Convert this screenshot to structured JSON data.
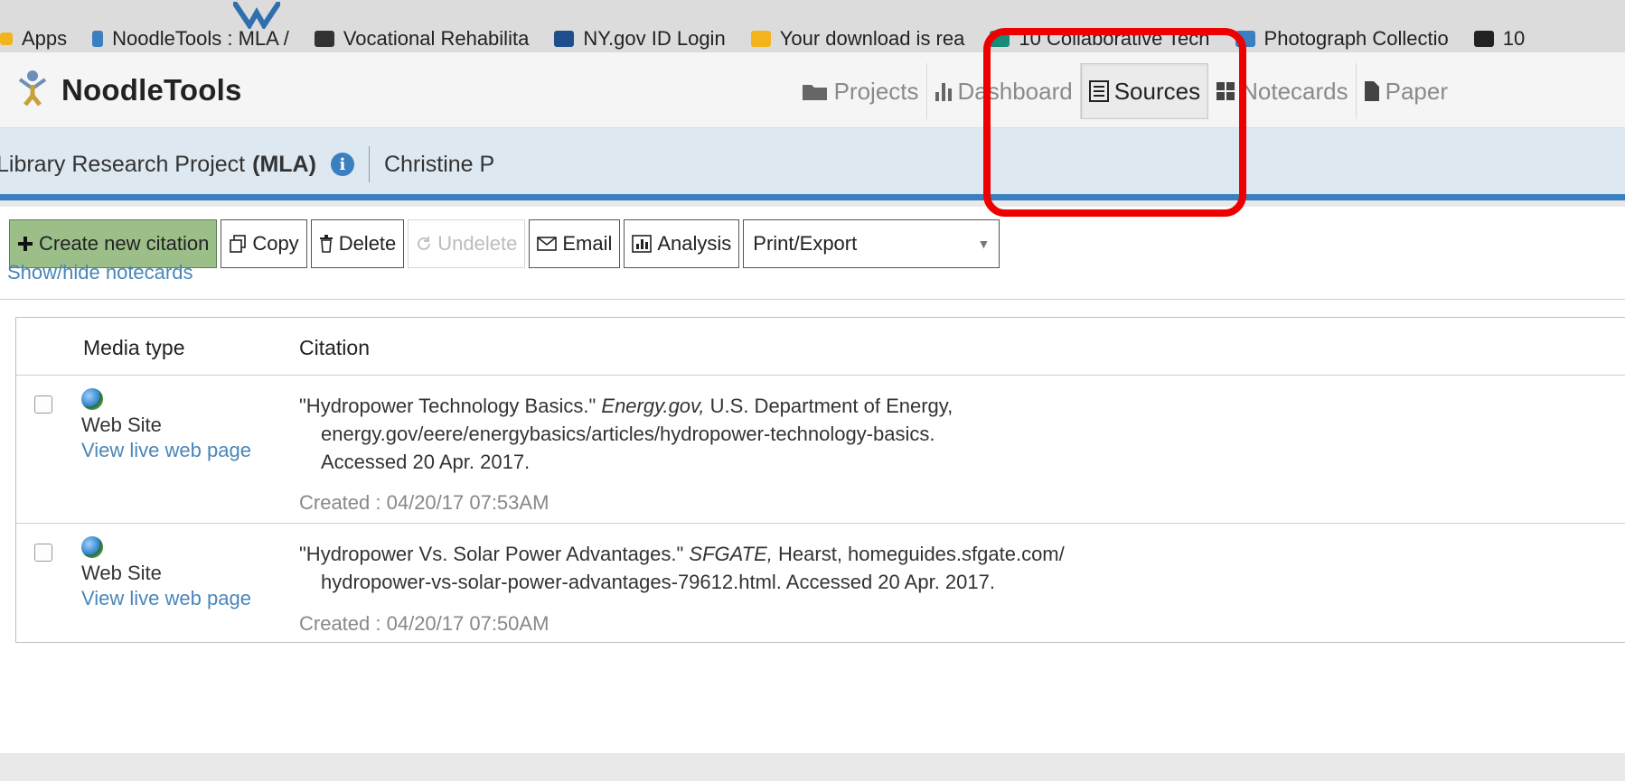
{
  "bookmarks": [
    {
      "label": "Apps",
      "color": "#f3b41b"
    },
    {
      "label": "NoodleTools : MLA /",
      "color": "#3a7fc0"
    },
    {
      "label": "Vocational Rehabilita",
      "color": "#333333"
    },
    {
      "label": "NY.gov ID Login",
      "color": "#1f4e8c"
    },
    {
      "label": "Your download is rea",
      "color": "#f3b41b"
    },
    {
      "label": "10 Collaborative Tech",
      "color": "#1a8a7a"
    },
    {
      "label": "Photograph Collectio",
      "color": "#3a7fc0"
    },
    {
      "label": "10",
      "color": "#222222"
    }
  ],
  "app": {
    "brand": "NoodleTools"
  },
  "nav": [
    {
      "label": "Projects",
      "icon": "folder-icon",
      "active": false
    },
    {
      "label": "Dashboard",
      "icon": "bar-chart-icon",
      "active": false
    },
    {
      "label": "Sources",
      "icon": "list-icon",
      "active": true
    },
    {
      "label": "Notecards",
      "icon": "grid-icon",
      "active": false
    },
    {
      "label": "Paper",
      "icon": "document-icon",
      "active": false
    }
  ],
  "project": {
    "title": "Library Research Project",
    "style": "(MLA)",
    "info_icon": "i",
    "owner": "Christine P"
  },
  "toolbar": {
    "create": "Create new citation",
    "copy": "Copy",
    "delete": "Delete",
    "undelete": "Undelete",
    "email": "Email",
    "analysis": "Analysis",
    "export_selected": "Print/Export"
  },
  "show_hide": "Show/hide notecards",
  "table": {
    "headers": {
      "media": "Media type",
      "citation": "Citation"
    },
    "rows": [
      {
        "media_type": "Web Site",
        "live_link": "View live web page",
        "cit_title": "\"Hydropower Technology Basics.\"",
        "cit_container": "Energy.gov,",
        "cit_rest1": "U.S. Department of Energy,",
        "cit_line2": "energy.gov/eere/energybasics/articles/hydropower-technology-basics.",
        "cit_line3": "Accessed 20 Apr. 2017.",
        "created": "Created : 04/20/17 07:53AM"
      },
      {
        "media_type": "Web Site",
        "live_link": "View live web page",
        "cit_title": "\"Hydropower Vs. Solar Power Advantages.\"",
        "cit_container": "SFGATE,",
        "cit_rest1": "Hearst, homeguides.sfgate.com/",
        "cit_line2": "hydropower-vs-solar-power-advantages-79612.html. Accessed 20 Apr. 2017.",
        "created": "Created : 04/20/17 07:50AM"
      }
    ]
  },
  "colors": {
    "accent_blue": "#3a7fc0",
    "create_button_green": "#9cbf8a",
    "highlight_red": "#ee0000",
    "link_blue": "#4a86b8"
  }
}
